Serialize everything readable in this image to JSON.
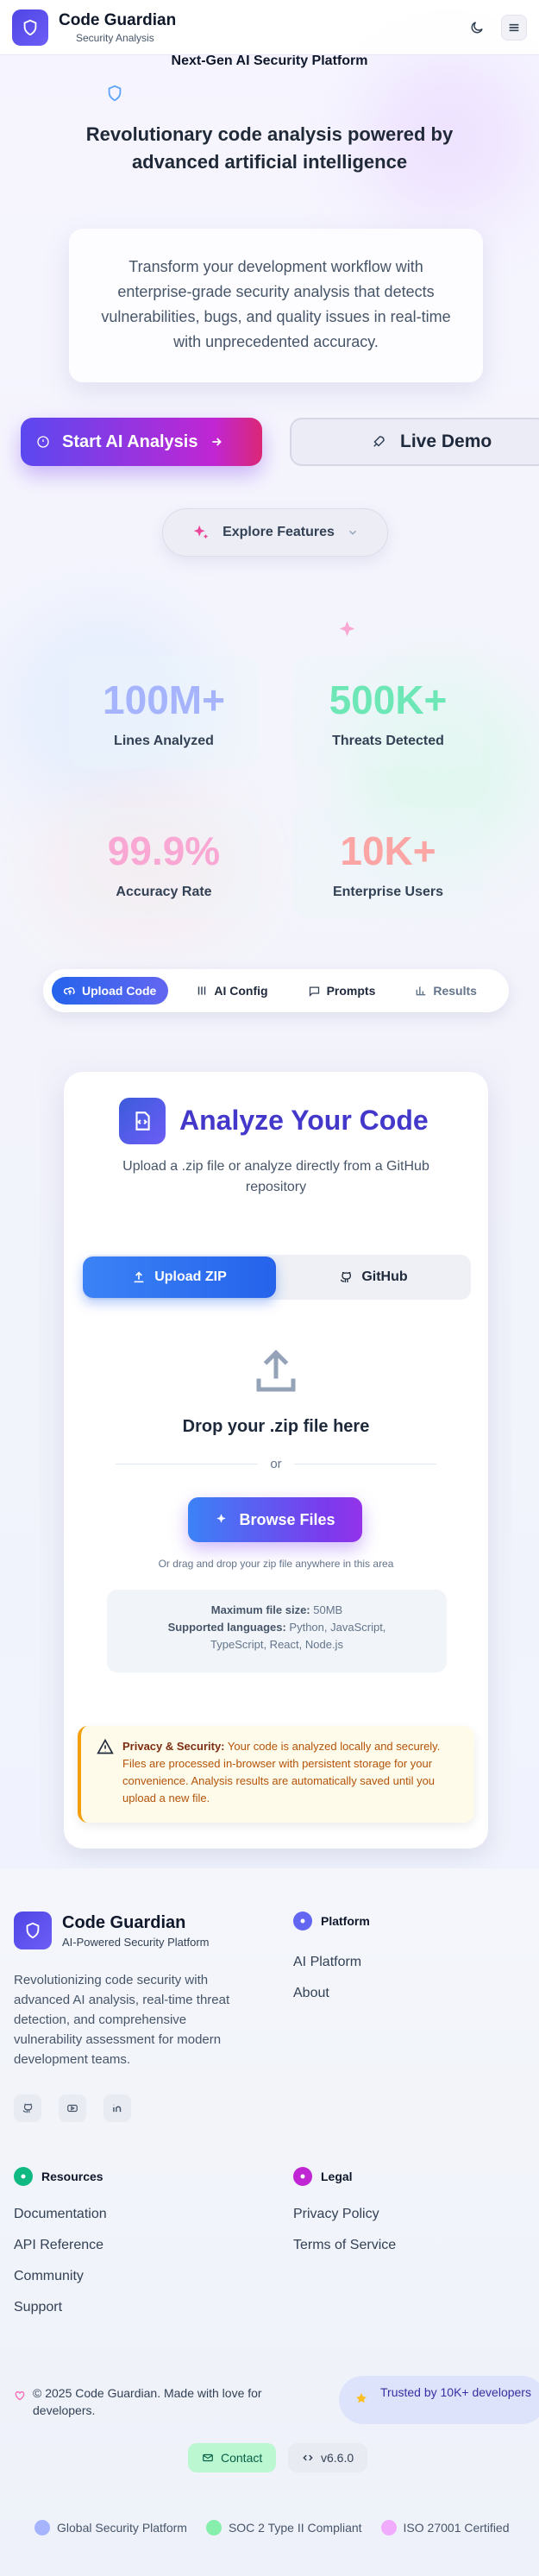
{
  "header": {
    "brand_title": "Code Guardian",
    "brand_subtitle": "Security Analysis",
    "icons": [
      "shield-icon",
      "moon-icon",
      "menu-icon"
    ]
  },
  "hero": {
    "tagline": "Next-Gen AI Security Platform",
    "title": "Revolutionary code analysis powered by advanced artificial intelligence",
    "description": "Transform your development workflow with enterprise-grade security analysis that detects vulnerabilities, bugs, and quality issues in real-time with unprecedented accuracy.",
    "start_label": "Start AI Analysis",
    "demo_label": "Live Demo",
    "explore_label": "Explore Features"
  },
  "stats": [
    {
      "value": "100M+",
      "label": "Lines Analyzed",
      "color": "#a5b4fc"
    },
    {
      "value": "500K+",
      "label": "Threats Detected",
      "color": "#6ee7b7"
    },
    {
      "value": "99.9%",
      "label": "Accuracy Rate",
      "color": "#f9a8d4"
    },
    {
      "value": "10K+",
      "label": "Enterprise Users",
      "color": "#fca5a5"
    }
  ],
  "tabs": [
    {
      "label": "Upload Code",
      "active": true
    },
    {
      "label": "AI Config"
    },
    {
      "label": "Prompts"
    },
    {
      "label": "Results"
    }
  ],
  "analyze": {
    "title": "Analyze Your Code",
    "subtitle": "Upload a .zip file or analyze directly from a GitHub repository",
    "seg_upload": "Upload ZIP",
    "seg_github": "GitHub",
    "drop_title": "Drop your .zip file here",
    "or": "or",
    "browse_label": "Browse Files",
    "drag_hint": "Or drag and drop your zip file anywhere in this area",
    "max_label": "Maximum file size:",
    "max_value": "50MB",
    "lang_label": "Supported languages:",
    "lang_value": "Python, JavaScript, TypeScript, React, Node.js",
    "privacy_label": "Privacy & Security:",
    "privacy_text": "Your code is analyzed locally and securely. Files are processed in-browser with persistent storage for your convenience. Analysis results are automatically saved until you upload a new file."
  },
  "footer": {
    "title": "Code Guardian",
    "subtitle": "AI-Powered Security Platform",
    "description": "Revolutionizing code security with advanced AI analysis, real-time threat detection, and comprehensive vulnerability assessment for modern development teams.",
    "platform_heading": "Platform",
    "platform_links": [
      "AI Platform",
      "About"
    ],
    "resources_heading": "Resources",
    "resources_links": [
      "Documentation",
      "API Reference",
      "Community",
      "Support"
    ],
    "legal_heading": "Legal",
    "legal_links": [
      "Privacy Policy",
      "Terms of Service"
    ],
    "copyright": "© 2025 Code Guardian. Made with love for developers.",
    "trusted": "Trusted by 10K+ developers",
    "contact_label": "Contact",
    "version_label": "v6.6.0",
    "badges": [
      "Global Security Platform",
      "SOC 2 Type II Compliant",
      "ISO 27001 Certified"
    ]
  }
}
